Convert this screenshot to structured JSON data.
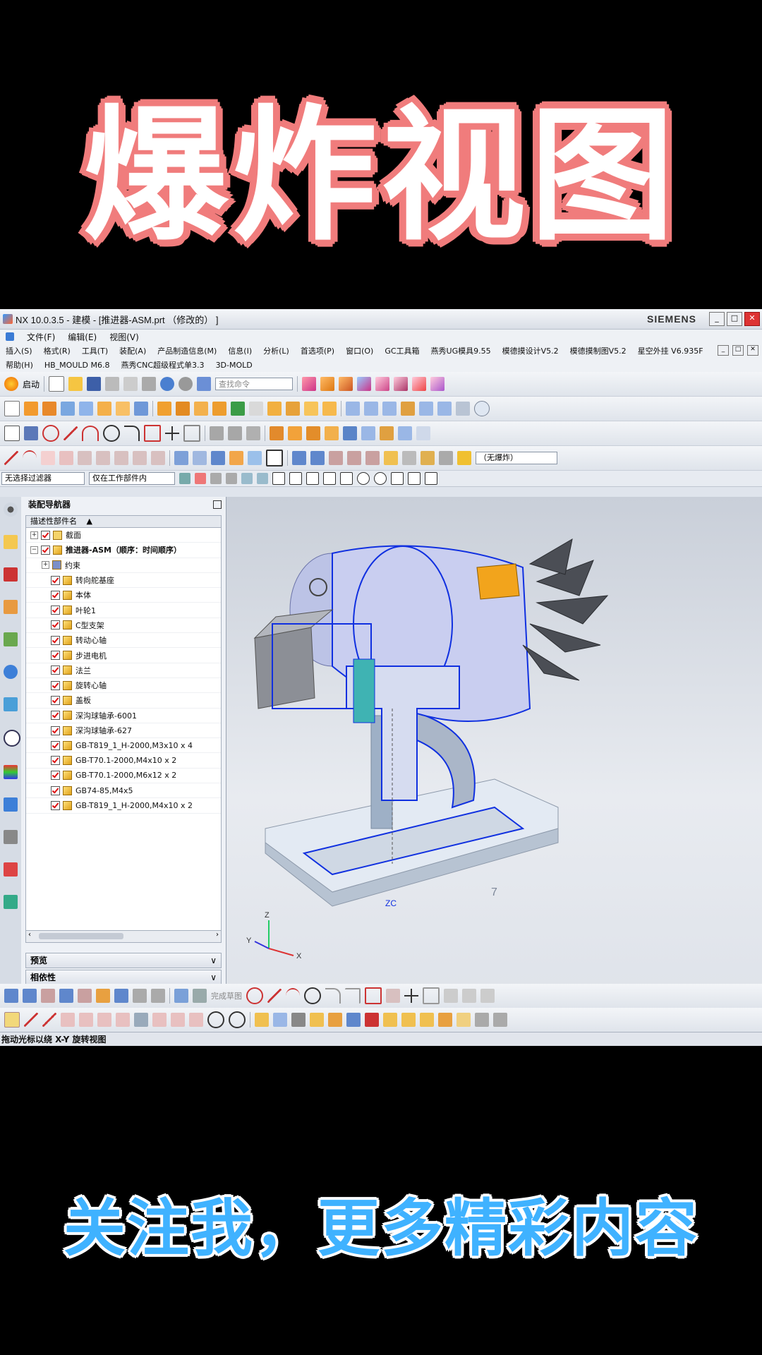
{
  "overlay": {
    "title": "爆炸视图",
    "subtitle": "关注我，更多精彩内容"
  },
  "window": {
    "title": "NX 10.0.3.5 - 建模 - [推进器-ASM.prt （修改的） ]",
    "brand": "SIEMENS"
  },
  "menu": {
    "items": [
      "文件(F)",
      "编辑(E)",
      "视图(V)"
    ]
  },
  "menu2": {
    "row1": [
      "插入(S)",
      "格式(R)",
      "工具(T)",
      "装配(A)",
      "产品制造信息(M)",
      "信息(I)",
      "分析(L)",
      "首选项(P)",
      "窗口(O)",
      "GC工具箱",
      "燕秀UG模具9.55",
      "模德摸设计V5.2",
      "模德摸制图V5.2",
      "星空外挂 V6.935F"
    ],
    "row2": [
      "帮助(H)",
      "HB_MOULD M6.8",
      "燕秀CNC超级程式单3.3",
      "3D-MOLD"
    ]
  },
  "toolbar": {
    "start_label": "启动",
    "search_placeholder": "查找命令",
    "explode_combo": "（无爆炸）"
  },
  "filters": {
    "selection_filter": "无选择过滤器",
    "scope": "仅在工作部件内"
  },
  "navigator": {
    "title": "装配导航器",
    "column_header": "描述性部件名",
    "tree": [
      {
        "level": 0,
        "label": "截面",
        "type": "folder"
      },
      {
        "level": 0,
        "label": "推进器-ASM（顺序：时间顺序）",
        "type": "root"
      },
      {
        "level": 1,
        "label": "约束",
        "type": "constraint"
      },
      {
        "level": 1,
        "label": "转向舵基座",
        "type": "part"
      },
      {
        "level": 1,
        "label": "本体",
        "type": "part"
      },
      {
        "level": 1,
        "label": "叶轮1",
        "type": "part"
      },
      {
        "level": 1,
        "label": "C型支架",
        "type": "part"
      },
      {
        "level": 1,
        "label": "转动心轴",
        "type": "part"
      },
      {
        "level": 1,
        "label": "步进电机",
        "type": "part"
      },
      {
        "level": 1,
        "label": "法兰",
        "type": "part"
      },
      {
        "level": 1,
        "label": "旋转心轴",
        "type": "part"
      },
      {
        "level": 1,
        "label": "盖板",
        "type": "part"
      },
      {
        "level": 1,
        "label": "深沟球轴承-6001",
        "type": "part"
      },
      {
        "level": 1,
        "label": "深沟球轴承-627",
        "type": "part"
      },
      {
        "level": 1,
        "label": "GB-T819_1_H-2000,M3x10 x 4",
        "type": "part"
      },
      {
        "level": 1,
        "label": "GB-T70.1-2000,M4x10 x 2",
        "type": "part"
      },
      {
        "level": 1,
        "label": "GB-T70.1-2000,M6x12 x 2",
        "type": "part"
      },
      {
        "level": 1,
        "label": "GB74-85,M4x5",
        "type": "part"
      },
      {
        "level": 1,
        "label": "GB-T819_1_H-2000,M4x10 x 2",
        "type": "part"
      }
    ],
    "preview_label": "预览",
    "dependency_label": "相依性"
  },
  "viewport": {
    "axis_z": "Z",
    "axis_x": "X",
    "axis_y": "Y",
    "zc_label": "ZC",
    "dim_label": "7"
  },
  "bottom_toolbar": {
    "finish_sketch": "完成草图"
  },
  "status": {
    "text": "拖动光标以绕 X-Y 旋转视图"
  },
  "colors": {
    "title_outline": "#f07c7c",
    "subtitle_fill": "#3fb2ff",
    "wireframe": "#1030e0"
  }
}
